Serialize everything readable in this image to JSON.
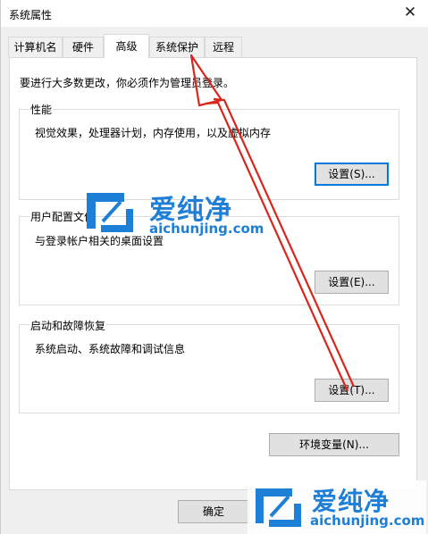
{
  "window": {
    "title": "系统属性"
  },
  "tabs": [
    {
      "label": "计算机名"
    },
    {
      "label": "硬件"
    },
    {
      "label": "高级"
    },
    {
      "label": "系统保护"
    },
    {
      "label": "远程"
    }
  ],
  "advanced": {
    "notice": "要进行大多数更改，你必须作为管理员登录。",
    "performance": {
      "title": "性能",
      "description": "视觉效果，处理器计划，内存使用，以及虚拟内存",
      "button": "设置(S)..."
    },
    "user_profiles": {
      "title": "用户配置文件",
      "description": "与登录帐户相关的桌面设置",
      "button": "设置(E)..."
    },
    "startup_recovery": {
      "title": "启动和故障恢复",
      "description": "系统启动、系统故障和调试信息",
      "button": "设置(T)..."
    },
    "env_button": "环境变量(N)..."
  },
  "footer": {
    "ok_button": "确定"
  },
  "watermark": {
    "brand": "爱纯净",
    "url": "aichunjing.com"
  },
  "colors": {
    "accent": "#0078d7",
    "arrow": "#d9261c",
    "watermark_blue": "#1e7fd6"
  }
}
